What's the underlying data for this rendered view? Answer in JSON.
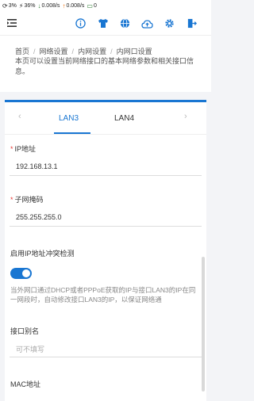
{
  "status_bar": {
    "item1": "3%",
    "item2": "36%",
    "item3": "0.008/s",
    "item4": "0.008/s",
    "item5": "0"
  },
  "breadcrumb": [
    "首页",
    "网络设置",
    "内网设置",
    "内网口设置"
  ],
  "description": "本页可以设置当前网络接口的基本网络参数和相关接口信息。",
  "tabs": {
    "active": "LAN3",
    "second": "LAN4"
  },
  "form": {
    "ip_label": "IP地址",
    "ip_value": "192.168.13.1",
    "mask_label": "子网掩码",
    "mask_value": "255.255.255.0",
    "conflict_label": "启用IP地址冲突检测",
    "conflict_enabled": true,
    "conflict_hint": "当外网口通过DHCP或者PPPoE获取的IP与接口LAN3的IP在同一网段时，自动修改接口LAN3的IP，以保证网络通",
    "alias_label": "接口别名",
    "alias_placeholder": "可不填写",
    "mac_label": "MAC地址"
  },
  "colors": {
    "accent": "#1976d2",
    "required": "#e53935"
  },
  "icons": [
    "hamburger-icon",
    "info-icon",
    "shirt-icon",
    "globe-icon",
    "cloud-upload-icon",
    "gear-icon",
    "logout-icon"
  ]
}
